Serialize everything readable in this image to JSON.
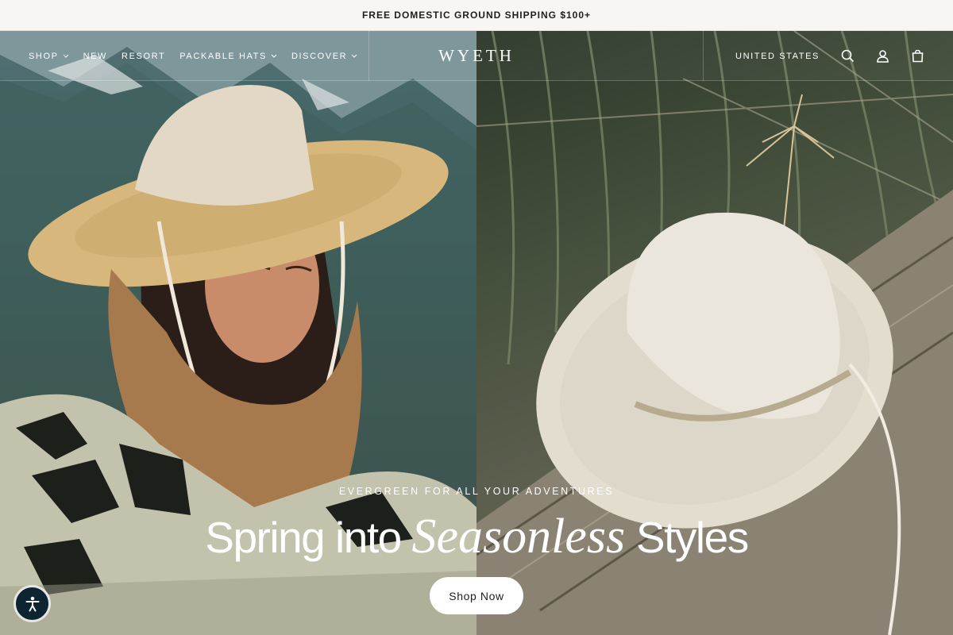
{
  "announcement": "FREE DOMESTIC GROUND SHIPPING $100+",
  "nav": {
    "items": [
      {
        "label": "SHOP",
        "has_dropdown": true
      },
      {
        "label": "NEW",
        "has_dropdown": false
      },
      {
        "label": "RESORT",
        "has_dropdown": false
      },
      {
        "label": "PACKABLE HATS",
        "has_dropdown": true
      },
      {
        "label": "DISCOVER",
        "has_dropdown": true
      }
    ],
    "logo": "WYETH",
    "region": "UNITED STATES",
    "icons": [
      "search-icon",
      "account-icon",
      "cart-icon"
    ]
  },
  "hero": {
    "eyebrow": "EVERGREEN FOR ALL YOUR ADVENTURES",
    "headline_before": "Spring into ",
    "headline_accent": "Seasonless",
    "headline_after": " Styles",
    "cta_label": "Shop Now"
  },
  "accessibility": {
    "icon": "accessibility-icon"
  },
  "colors": {
    "announcement_bg": "#f7f6f3",
    "text_dark": "#1e1e1e",
    "cta_bg": "#ffffff",
    "a11y_bg": "#0d2431"
  }
}
